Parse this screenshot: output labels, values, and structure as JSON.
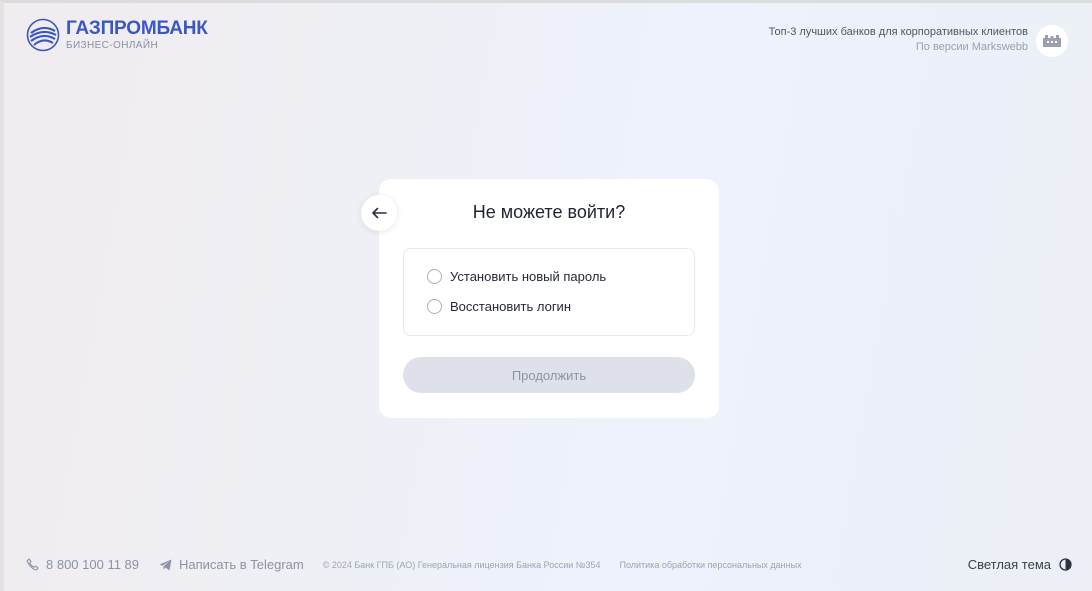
{
  "header": {
    "logo_title": "ГАЗПРОМБАНК",
    "logo_subtitle": "БИЗНЕС-ОНЛАЙН",
    "rating_title": "Топ-3 лучших банков для корпоративных клиентов",
    "rating_source": "По версии Markswebb"
  },
  "card": {
    "title": "Не можете войти?",
    "options": [
      {
        "label": "Установить новый пароль",
        "selected": false
      },
      {
        "label": "Восстановить логин",
        "selected": false
      }
    ],
    "continue_label": "Продолжить"
  },
  "footer": {
    "phone": "8 800 100 11 89",
    "telegram": "Написать в Telegram",
    "copyright": "© 2024 Банк ГПБ (АО) Генеральная лицензия Банка России №354",
    "privacy": "Политика обработки персональных данных",
    "theme_label": "Светлая тема"
  },
  "colors": {
    "brand": "#3b57c4",
    "button_disabled_bg": "#dee1ea",
    "button_disabled_text": "#8c93a6"
  },
  "icons": [
    "logo-globe-icon",
    "rating-badge-icon",
    "back-arrow-icon",
    "phone-icon",
    "telegram-icon",
    "theme-toggle-icon"
  ]
}
